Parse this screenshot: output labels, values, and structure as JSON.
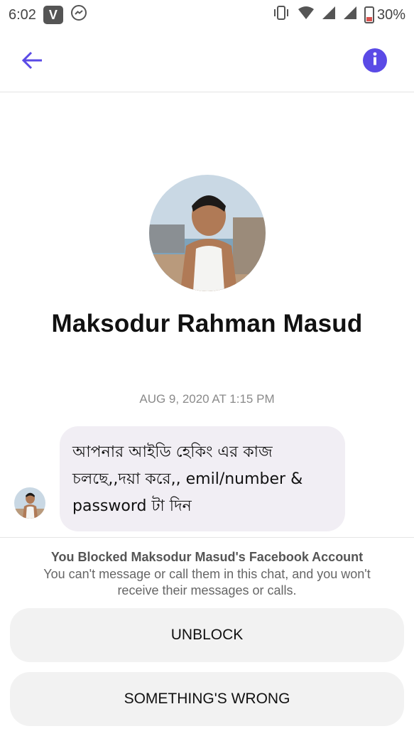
{
  "status_bar": {
    "time": "6:02",
    "app_badge": "V",
    "battery": "30%"
  },
  "app_bar": {
    "back_icon": "arrow-left-icon",
    "info_icon": "info-circle-icon",
    "accent_color": "#5a4ae6"
  },
  "profile": {
    "name": "Maksodur Rahman Masud"
  },
  "conversation": {
    "timestamp": "AUG 9, 2020 AT 1:15 PM",
    "messages": [
      {
        "line1": "আপনার আইডি হেকিং এর কাজ",
        "line2": "চলছে,,দয়া করে,, emil/number &",
        "line3": "password টা দিন"
      }
    ]
  },
  "blocked_notice": {
    "title": "You Blocked Maksodur Masud's Facebook Account",
    "description": "You can't message or call them in this chat, and you won't receive their messages or calls."
  },
  "actions": {
    "unblock_label": "UNBLOCK",
    "something_wrong_label": "SOMETHING'S WRONG"
  }
}
